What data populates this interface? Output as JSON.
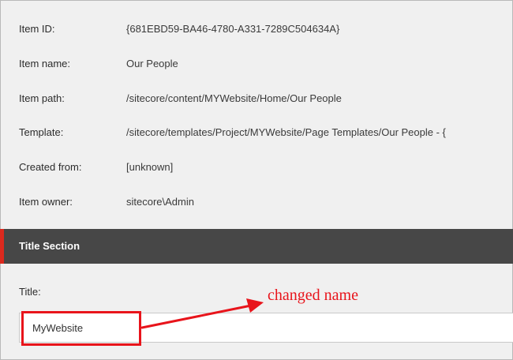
{
  "item_info": {
    "rows": [
      {
        "label": "Item ID:",
        "value": "{681EBD59-BA46-4780-A331-7289C504634A}"
      },
      {
        "label": "Item name:",
        "value": "Our People"
      },
      {
        "label": "Item path:",
        "value": "/sitecore/content/MYWebsite/Home/Our People"
      },
      {
        "label": "Template:",
        "value": "/sitecore/templates/Project/MYWebsite/Page Templates/Our People - {"
      },
      {
        "label": "Created from:",
        "value": "[unknown]"
      },
      {
        "label": "Item owner:",
        "value": "sitecore\\Admin"
      }
    ]
  },
  "title_section": {
    "header": "Title Section",
    "field_label": "Title:",
    "field_value": "MyWebsite"
  },
  "annotation": {
    "text": "changed name",
    "color": "#e8141b"
  },
  "colors": {
    "section_header_bg": "#474747",
    "section_accent": "#dc291e",
    "panel_bg": "#f0f0f0"
  }
}
